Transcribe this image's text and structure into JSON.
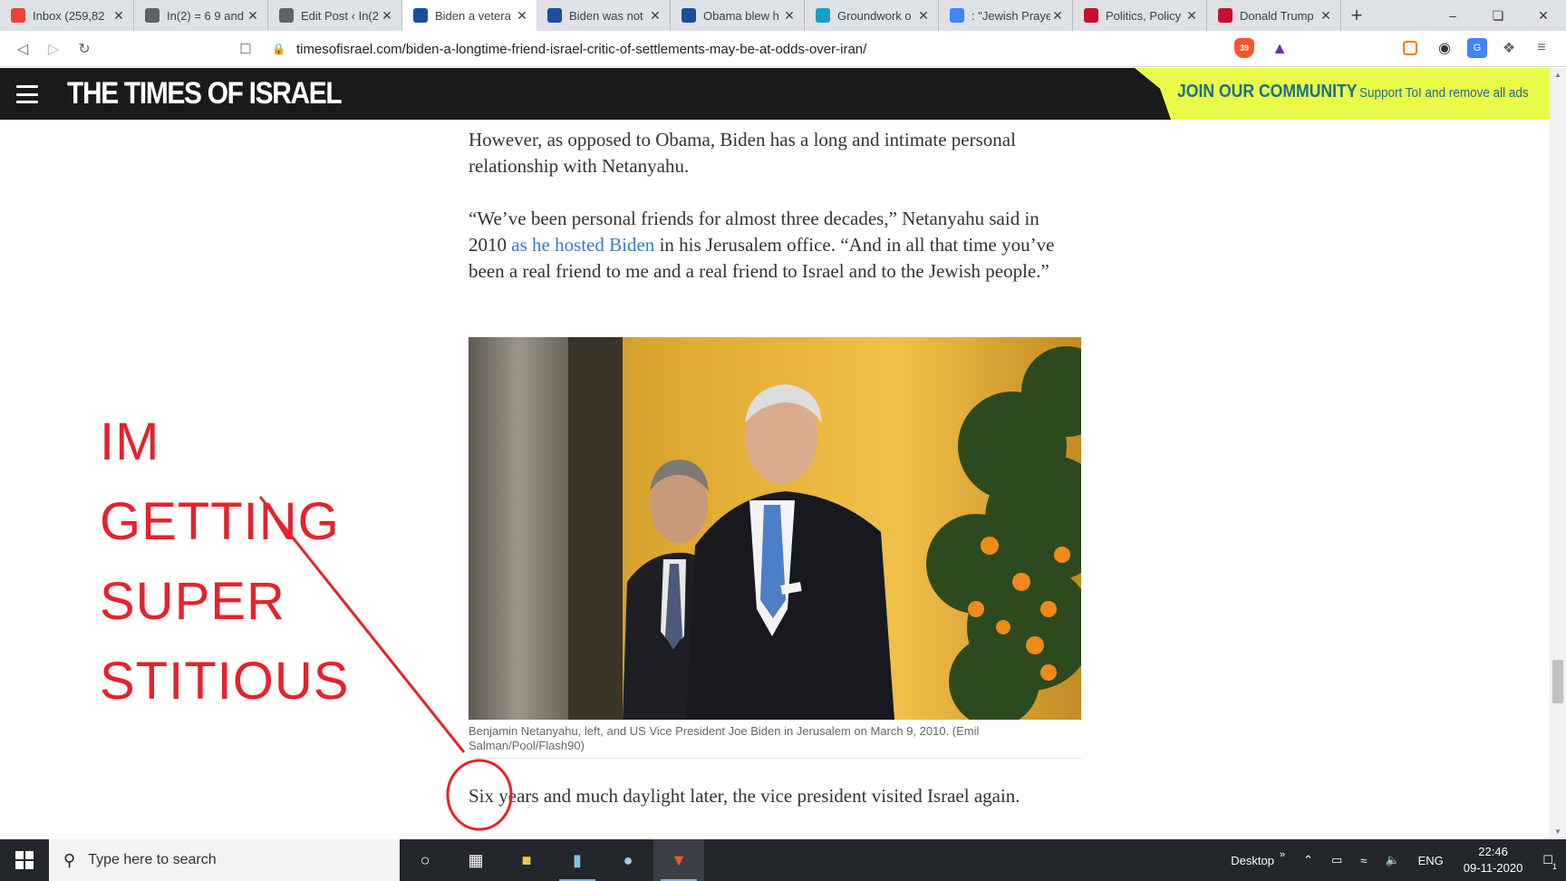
{
  "browser": {
    "tabs": [
      {
        "title": "Inbox (259,82",
        "favicon": "gmail-icon",
        "color": "#ea4335",
        "active": false
      },
      {
        "title": "In(2) = 6 9 and",
        "favicon": "globe-icon",
        "color": "#5f6368",
        "active": false
      },
      {
        "title": "Edit Post ‹ In(2",
        "favicon": "wordpress-icon",
        "color": "#5f6368",
        "active": false
      },
      {
        "title": "Biden a vetera",
        "favicon": "times-of-israel-icon",
        "color": "#1b4f9c",
        "active": true
      },
      {
        "title": "Biden was not",
        "favicon": "times-of-israel-icon",
        "color": "#1b4f9c",
        "active": false
      },
      {
        "title": "Obama blew h",
        "favicon": "times-of-israel-icon",
        "color": "#1b4f9c",
        "active": false
      },
      {
        "title": "Groundwork o",
        "favicon": "haaretz-icon",
        "color": "#16a0c7",
        "active": false
      },
      {
        "title": ": \"Jewish Praye",
        "favicon": "google-icon",
        "color": "#4285f4",
        "active": false
      },
      {
        "title": "Politics, Policy",
        "favicon": "politico-icon",
        "color": "#c8102e",
        "active": false
      },
      {
        "title": "Donald Trump",
        "favicon": "politico-icon",
        "color": "#c8102e",
        "active": false
      }
    ],
    "new_tab_label": "+",
    "url": "timesofisrael.com/biden-a-longtime-friend-israel-critic-of-settlements-may-be-at-odds-over-iran/",
    "brave_shield_count": "39"
  },
  "site": {
    "logo": "THE TIMES OF ISRAEL",
    "promo_title": "JOIN OUR COMMUNITY",
    "promo_sub": "Support ToI and remove all ads",
    "promo_color": "#e9fa48",
    "header_bg": "#1a1a1a"
  },
  "article": {
    "para1": "However, as opposed to Obama, Biden has a long and intimate personal relationship with Netanyahu.",
    "para2_a": "“We’ve been personal friends for almost three decades,” Netanyahu said in 2010 ",
    "para2_link": "as he hosted Biden",
    "para2_b": " in his Jerusalem office. “And in all that time you’ve been a real friend to me and a real friend to Israel and to the Jewish people.”",
    "photo_caption": "Benjamin Netanyahu, left, and US Vice President Joe Biden in Jerusalem on March 9, 2010. (Emil Salman/Pool/Flash90)",
    "para3": "Six years and much daylight later, the vice president visited Israel again."
  },
  "annotation": {
    "lines": [
      "IM",
      "GETTING",
      "SUPER",
      "STITIOUS"
    ],
    "color": "#e5222c"
  },
  "taskbar": {
    "search_placeholder": "Type here to search",
    "desktop_label": "Desktop",
    "language": "ENG",
    "time": "22:46",
    "date": "09-11-2020",
    "notification_count": "1"
  }
}
